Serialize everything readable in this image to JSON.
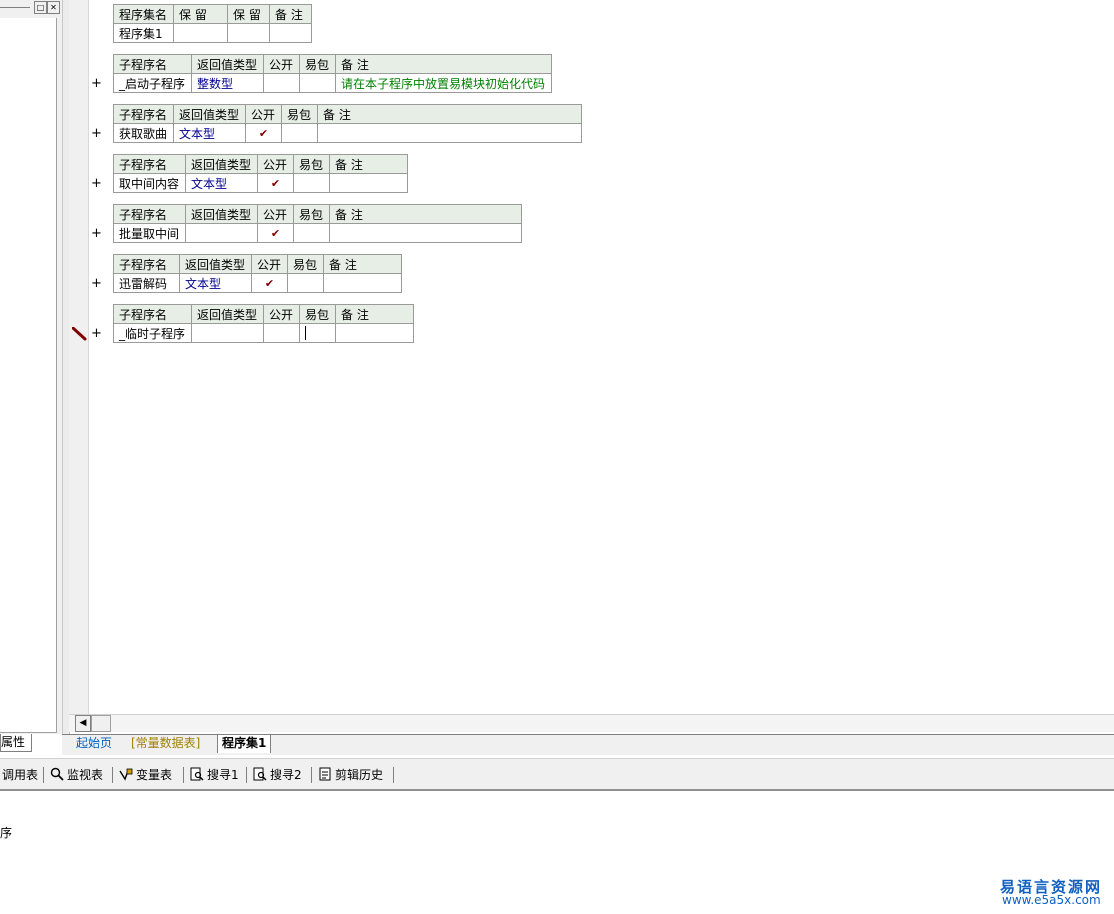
{
  "left_panel": {
    "tab_label": "属性"
  },
  "program_set": {
    "headers": [
      "程序集名",
      "保 留",
      "保 留",
      "备 注"
    ],
    "row": [
      "程序集1",
      "",
      "",
      ""
    ]
  },
  "subroutines": [
    {
      "headers": [
        "子程序名",
        "返回值类型",
        "公开",
        "易包",
        "备 注"
      ],
      "name": "_启动子程序",
      "return_type": "整数型",
      "public": "",
      "pkg": "",
      "remark": "请在本子程序中放置易模块初始化代码"
    },
    {
      "headers": [
        "子程序名",
        "返回值类型",
        "公开",
        "易包",
        "备 注"
      ],
      "name": "获取歌曲",
      "return_type": "文本型",
      "public": "✔",
      "pkg": "",
      "remark": ""
    },
    {
      "headers": [
        "子程序名",
        "返回值类型",
        "公开",
        "易包",
        "备 注"
      ],
      "name": "取中间内容",
      "return_type": "文本型",
      "public": "✔",
      "pkg": "",
      "remark": ""
    },
    {
      "headers": [
        "子程序名",
        "返回值类型",
        "公开",
        "易包",
        "备 注"
      ],
      "name": "批量取中间",
      "return_type": "",
      "public": "✔",
      "pkg": "",
      "remark": ""
    },
    {
      "headers": [
        "子程序名",
        "返回值类型",
        "公开",
        "易包",
        "备 注"
      ],
      "name": "迅雷解码",
      "return_type": "文本型",
      "public": "✔",
      "pkg": "",
      "remark": ""
    },
    {
      "headers": [
        "子程序名",
        "返回值类型",
        "公开",
        "易包",
        "备 注"
      ],
      "name": "_临时子程序",
      "return_type": "",
      "public": "",
      "pkg": "",
      "remark": ""
    }
  ],
  "gutter": {
    "plus": "+"
  },
  "tabs": {
    "start": "起始页",
    "const": "[常量数据表]",
    "active": "程序集1"
  },
  "toolbar": {
    "calls": "调用表",
    "watch": "监视表",
    "vars": "变量表",
    "search1": "搜寻1",
    "search2": "搜寻2",
    "clip": "剪辑历史"
  },
  "output_text": "序",
  "watermark": {
    "title": "易语言资源网",
    "url": "www.e5a5x.com"
  }
}
